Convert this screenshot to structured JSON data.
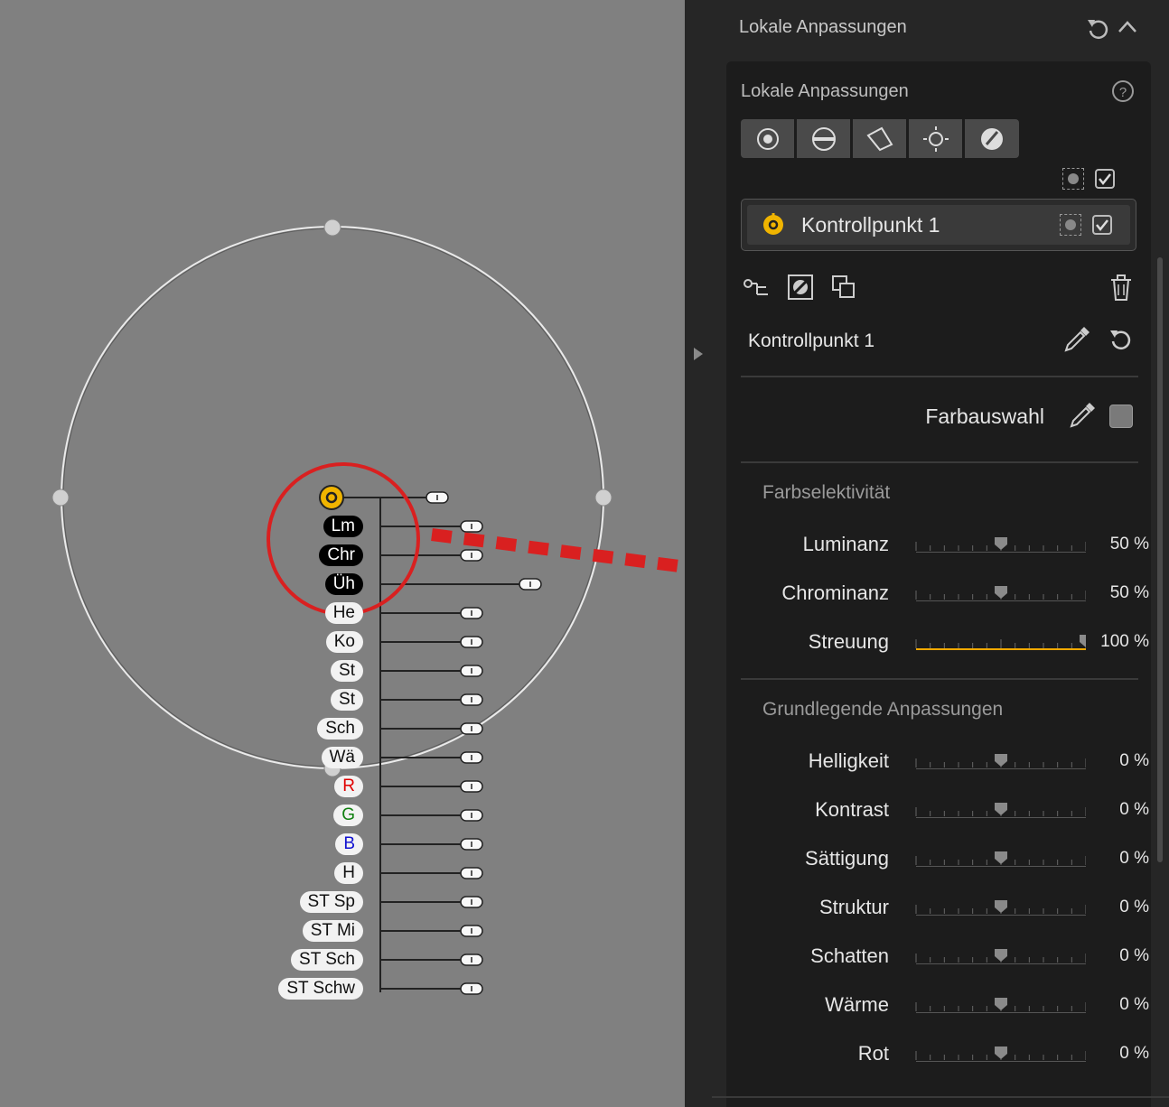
{
  "canvas": {
    "tags": [
      {
        "label": "Lm",
        "style": "dark"
      },
      {
        "label": "Chr",
        "style": "dark"
      },
      {
        "label": "Üh",
        "style": "dark"
      },
      {
        "label": "He",
        "style": "light"
      },
      {
        "label": "Ko",
        "style": "light"
      },
      {
        "label": "St",
        "style": "light"
      },
      {
        "label": "St",
        "style": "light"
      },
      {
        "label": "Sch",
        "style": "light"
      },
      {
        "label": "Wä",
        "style": "light"
      },
      {
        "label": "R",
        "style": "light",
        "color": "#e00000"
      },
      {
        "label": "G",
        "style": "light",
        "color": "#108010"
      },
      {
        "label": "B",
        "style": "light",
        "color": "#1010d0"
      },
      {
        "label": "H",
        "style": "light"
      },
      {
        "label": "ST Sp",
        "style": "light"
      },
      {
        "label": "ST Mi",
        "style": "light"
      },
      {
        "label": "ST Sch",
        "style": "light"
      },
      {
        "label": "ST Schw",
        "style": "light"
      }
    ],
    "annotation_color": "#d92020",
    "control_point_color": "#f0b400"
  },
  "panel": {
    "header_title": "Lokale Anpassungen",
    "inner_title": "Lokale Anpassungen",
    "control_point_name": "Kontrollpunkt 1",
    "point_title": "Kontrollpunkt 1",
    "color_pick_label": "Farbauswahl",
    "section_selectivity": "Farbselektivität",
    "selectivity_rows": [
      {
        "label": "Luminanz",
        "value": "50 %",
        "level": 0.5
      },
      {
        "label": "Chrominanz",
        "value": "50 %",
        "level": 0.5
      },
      {
        "label": "Streuung",
        "value": "100 %",
        "level": 1.0,
        "filled": true
      }
    ],
    "section_basic": "Grundlegende Anpassungen",
    "basic_rows": [
      {
        "label": "Helligkeit",
        "value": "0 %",
        "level": 0.5
      },
      {
        "label": "Kontrast",
        "value": "0 %",
        "level": 0.5
      },
      {
        "label": "Sättigung",
        "value": "0 %",
        "level": 0.5
      },
      {
        "label": "Struktur",
        "value": "0 %",
        "level": 0.5
      },
      {
        "label": "Schatten",
        "value": "0 %",
        "level": 0.5
      },
      {
        "label": "Wärme",
        "value": "0 %",
        "level": 0.5
      },
      {
        "label": "Rot",
        "value": "0 %",
        "level": 0.5
      }
    ],
    "accent_color": "#f0a800"
  }
}
